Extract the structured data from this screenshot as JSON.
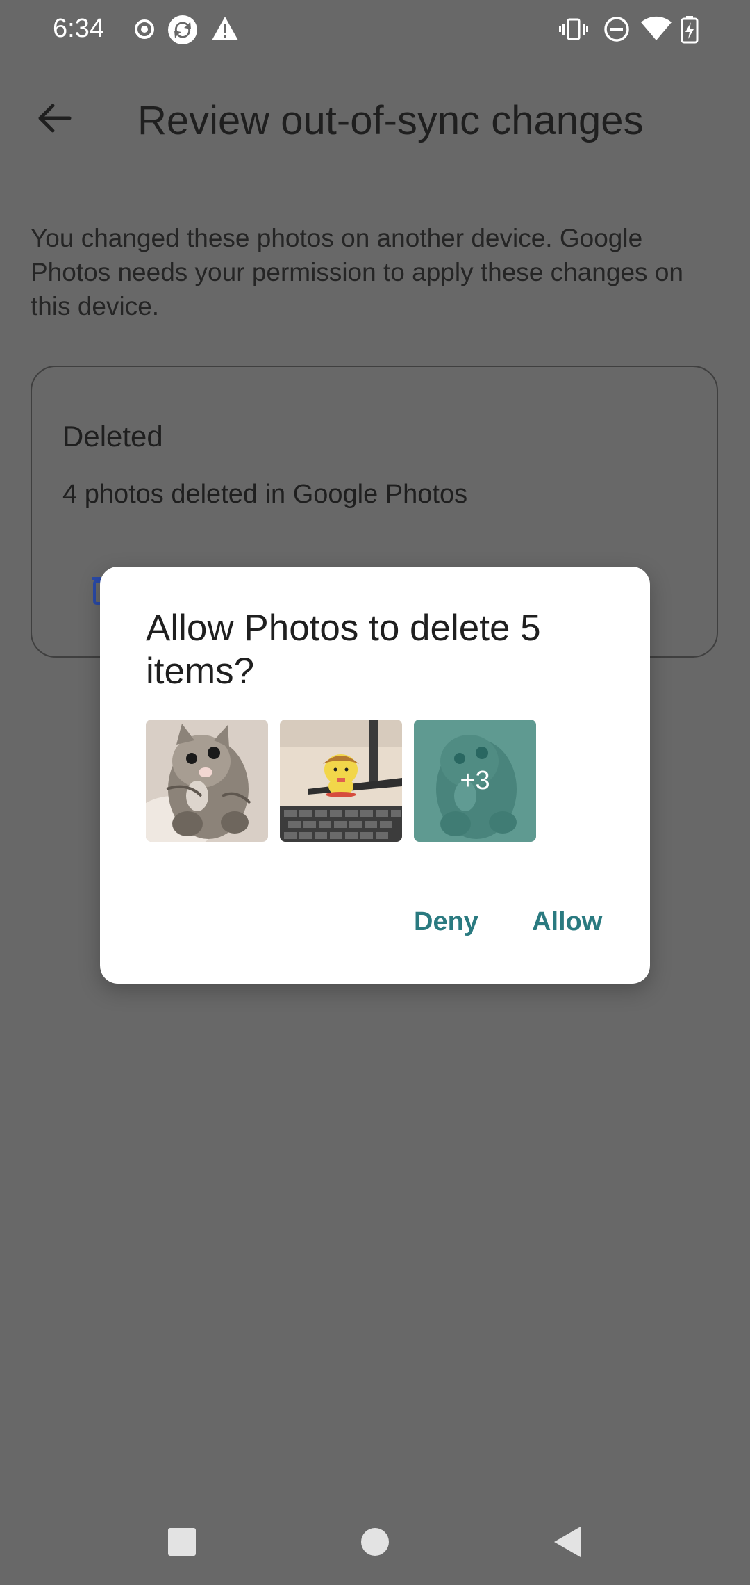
{
  "status_bar": {
    "time": "6:34",
    "left_icons": [
      "record-icon",
      "sync-icon",
      "warning-icon"
    ],
    "right_icons": [
      "vibrate-icon",
      "do-not-disturb-icon",
      "wifi-icon",
      "battery-charging-icon"
    ]
  },
  "app_bar": {
    "title": "Review out-of-sync changes",
    "back_icon": "arrow-back-icon"
  },
  "description": "You changed these photos on another device. Google Photos needs your permission to apply these changes on this device.",
  "card": {
    "title": "Deleted",
    "subtitle": "4 photos deleted in Google Photos",
    "icon": "delete-icon"
  },
  "dialog": {
    "title": "Allow Photos to delete 5 items?",
    "thumbnails": [
      "kitten-photo",
      "toy-on-desk-photo",
      "kitten-photo"
    ],
    "more_count": "+3",
    "deny_label": "Deny",
    "allow_label": "Allow"
  },
  "nav_bar": {
    "icons": [
      "recents-icon",
      "home-icon",
      "back-icon"
    ]
  },
  "colors": {
    "scrim": "#686868",
    "accent": "#2a7a80",
    "dialog_bg": "#ffffff"
  }
}
